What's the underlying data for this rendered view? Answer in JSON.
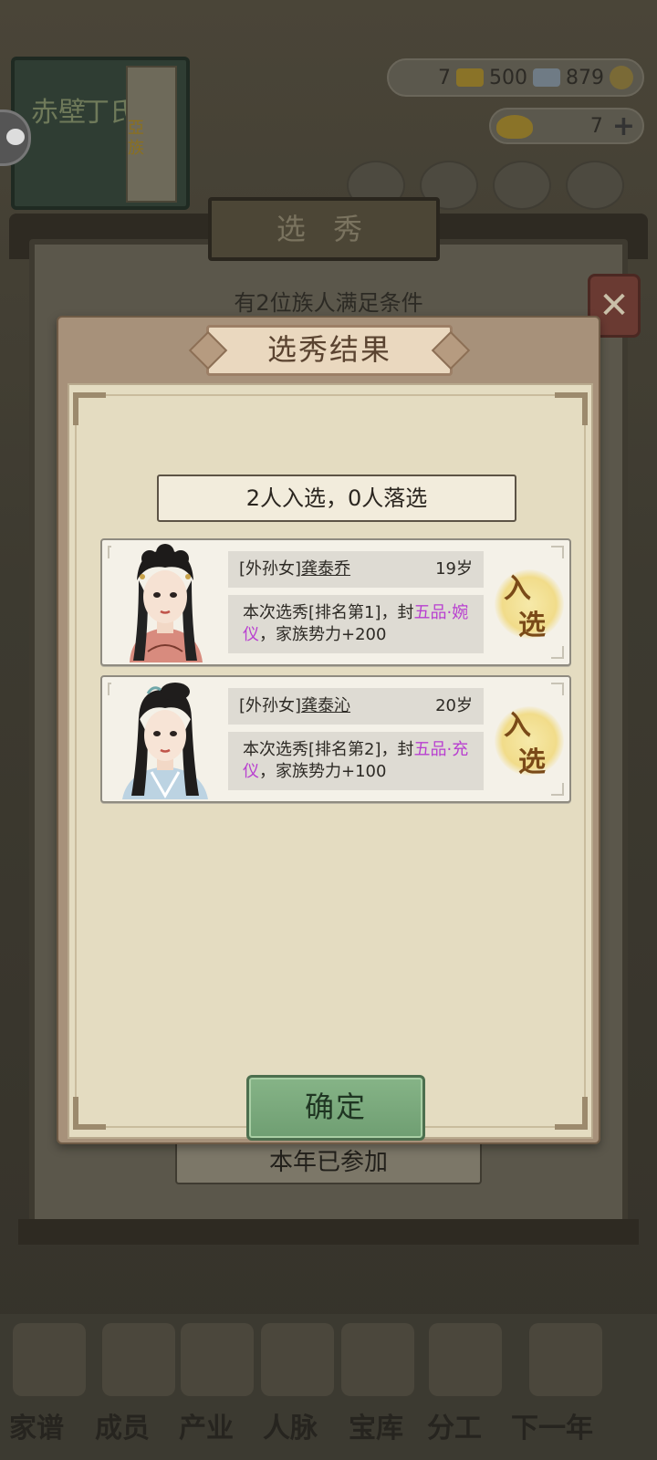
{
  "background": {
    "book": {
      "title_left": "赤壁",
      "title_right": "丁氏",
      "spine_text": "亞族"
    },
    "resources": {
      "gold": "7",
      "silver": "500",
      "coins": "879"
    },
    "ingots": "7",
    "outer_panel": {
      "title": "选 秀",
      "subtitle": "有2位族人满足条件",
      "footer_button": "本年已参加"
    },
    "bottom_nav": [
      "家谱",
      "成员",
      "产业",
      "人脉",
      "宝库",
      "分工",
      "下一年"
    ]
  },
  "modal": {
    "title": "选秀结果",
    "summary": "2人入选，0人落选",
    "confirm": "确定",
    "cards": [
      {
        "relation": "[外孙女]",
        "name": "龚泰乔",
        "age": "19岁",
        "desc_prefix": "本次选秀[排名第1]，封",
        "rank_title": "五品·婉仪",
        "desc_suffix": "，家族势力+200",
        "stamp": [
          "入",
          "选"
        ]
      },
      {
        "relation": "[外孙女]",
        "name": "龚泰沁",
        "age": "20岁",
        "desc_prefix": "本次选秀[排名第2]，封",
        "rank_title": "五品·充仪",
        "desc_suffix": "，家族势力+100",
        "stamp": [
          "入",
          "选"
        ]
      }
    ]
  },
  "colors": {
    "highlight": "#b83fd0",
    "confirm_green": "#7aa97c",
    "modal_frame": "#a7917a"
  }
}
